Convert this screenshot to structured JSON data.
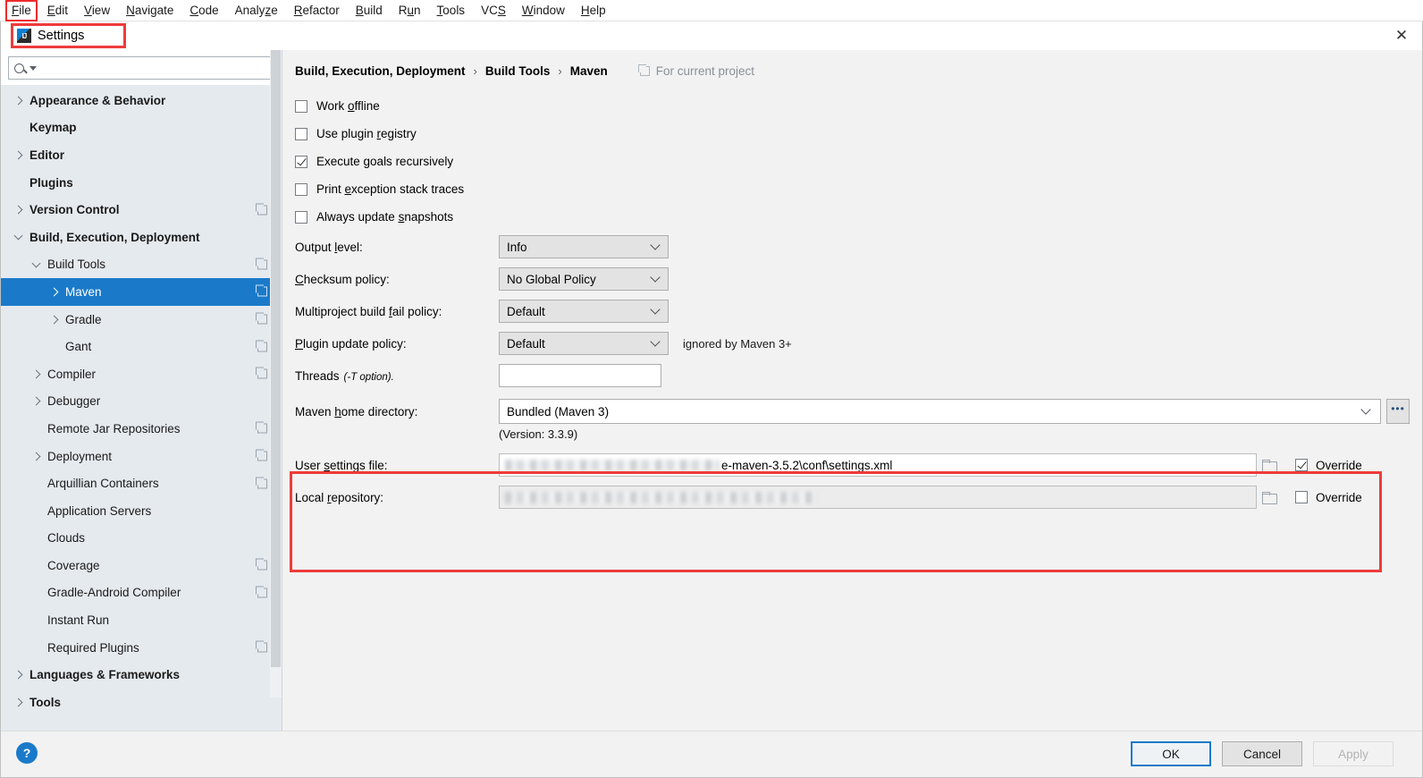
{
  "menubar": {
    "items": [
      {
        "label": "File",
        "mnemonic": "F",
        "highlighted": true
      },
      {
        "label": "Edit",
        "mnemonic": "E"
      },
      {
        "label": "View",
        "mnemonic": "V"
      },
      {
        "label": "Navigate",
        "mnemonic": "N"
      },
      {
        "label": "Code",
        "mnemonic": "C"
      },
      {
        "label": "Analyze",
        "mnemonic": "z"
      },
      {
        "label": "Refactor",
        "mnemonic": "R"
      },
      {
        "label": "Build",
        "mnemonic": "B"
      },
      {
        "label": "Run",
        "mnemonic": "u"
      },
      {
        "label": "Tools",
        "mnemonic": "T"
      },
      {
        "label": "VCS",
        "mnemonic": "S"
      },
      {
        "label": "Window",
        "mnemonic": "W"
      },
      {
        "label": "Help",
        "mnemonic": "H"
      }
    ]
  },
  "dialog": {
    "title": "Settings",
    "close_label": "✕"
  },
  "search": {
    "value": "",
    "placeholder": ""
  },
  "sidebar": {
    "items": [
      {
        "label": "Appearance & Behavior",
        "indent": 0,
        "bold": true,
        "chevron": "closed",
        "copy": false,
        "selected": false
      },
      {
        "label": "Keymap",
        "indent": 0,
        "bold": true,
        "chevron": "none",
        "copy": false,
        "selected": false
      },
      {
        "label": "Editor",
        "indent": 0,
        "bold": true,
        "chevron": "closed",
        "copy": false,
        "selected": false
      },
      {
        "label": "Plugins",
        "indent": 0,
        "bold": true,
        "chevron": "none",
        "copy": false,
        "selected": false
      },
      {
        "label": "Version Control",
        "indent": 0,
        "bold": true,
        "chevron": "closed",
        "copy": true,
        "selected": false
      },
      {
        "label": "Build, Execution, Deployment",
        "indent": 0,
        "bold": true,
        "chevron": "open",
        "copy": false,
        "selected": false
      },
      {
        "label": "Build Tools",
        "indent": 1,
        "bold": false,
        "chevron": "open",
        "copy": true,
        "selected": false
      },
      {
        "label": "Maven",
        "indent": 2,
        "bold": false,
        "chevron": "closed",
        "copy": true,
        "selected": true
      },
      {
        "label": "Gradle",
        "indent": 2,
        "bold": false,
        "chevron": "closed",
        "copy": true,
        "selected": false
      },
      {
        "label": "Gant",
        "indent": 2,
        "bold": false,
        "chevron": "none",
        "copy": true,
        "selected": false
      },
      {
        "label": "Compiler",
        "indent": 1,
        "bold": false,
        "chevron": "closed",
        "copy": true,
        "selected": false
      },
      {
        "label": "Debugger",
        "indent": 1,
        "bold": false,
        "chevron": "closed",
        "copy": false,
        "selected": false
      },
      {
        "label": "Remote Jar Repositories",
        "indent": 1,
        "bold": false,
        "chevron": "none",
        "copy": true,
        "selected": false
      },
      {
        "label": "Deployment",
        "indent": 1,
        "bold": false,
        "chevron": "closed",
        "copy": true,
        "selected": false
      },
      {
        "label": "Arquillian Containers",
        "indent": 1,
        "bold": false,
        "chevron": "none",
        "copy": true,
        "selected": false
      },
      {
        "label": "Application Servers",
        "indent": 1,
        "bold": false,
        "chevron": "none",
        "copy": false,
        "selected": false
      },
      {
        "label": "Clouds",
        "indent": 1,
        "bold": false,
        "chevron": "none",
        "copy": false,
        "selected": false
      },
      {
        "label": "Coverage",
        "indent": 1,
        "bold": false,
        "chevron": "none",
        "copy": true,
        "selected": false
      },
      {
        "label": "Gradle-Android Compiler",
        "indent": 1,
        "bold": false,
        "chevron": "none",
        "copy": true,
        "selected": false
      },
      {
        "label": "Instant Run",
        "indent": 1,
        "bold": false,
        "chevron": "none",
        "copy": false,
        "selected": false
      },
      {
        "label": "Required Plugins",
        "indent": 1,
        "bold": false,
        "chevron": "none",
        "copy": true,
        "selected": false
      },
      {
        "label": "Languages & Frameworks",
        "indent": 0,
        "bold": true,
        "chevron": "closed",
        "copy": false,
        "selected": false
      },
      {
        "label": "Tools",
        "indent": 0,
        "bold": true,
        "chevron": "closed",
        "copy": false,
        "selected": false
      }
    ]
  },
  "main": {
    "breadcrumb": [
      "Build, Execution, Deployment",
      "Build Tools",
      "Maven"
    ],
    "breadcrumb_separator": "›",
    "scope_label": "For current project",
    "checkboxes": [
      {
        "label_pre": "Work ",
        "label_mn": "o",
        "label_post": "ffline",
        "checked": false
      },
      {
        "label_pre": "Use plugin ",
        "label_mn": "r",
        "label_post": "egistry",
        "checked": false
      },
      {
        "label_pre": "Execute ",
        "label_mn": "g",
        "label_post": "oals recursively",
        "checked": true
      },
      {
        "label_pre": "Print ",
        "label_mn": "e",
        "label_post": "xception stack traces",
        "checked": false
      },
      {
        "label_pre": "Always update ",
        "label_mn": "s",
        "label_post": "napshots",
        "checked": false
      }
    ],
    "combos": [
      {
        "label_pre": "Output ",
        "label_mn": "l",
        "label_post": "evel:",
        "value": "Info",
        "hint": ""
      },
      {
        "label_pre": "",
        "label_mn": "C",
        "label_post": "hecksum policy:",
        "value": "No Global Policy",
        "hint": ""
      },
      {
        "label_pre": "Multiproject build ",
        "label_mn": "f",
        "label_post": "ail policy:",
        "value": "Default",
        "hint": ""
      },
      {
        "label_pre": "",
        "label_mn": "P",
        "label_post": "lugin update policy:",
        "value": "Default",
        "hint": "ignored by Maven 3+"
      }
    ],
    "threads": {
      "label": "Threads",
      "hint": "(-T option).",
      "value": ""
    },
    "maven_home": {
      "label_pre": "Maven ",
      "label_mn": "h",
      "label_post": "ome directory:",
      "value": "Bundled (Maven 3)",
      "browse_label": "•••",
      "version_text": "(Version: 3.3.9)"
    },
    "user_settings_file": {
      "label_pre": "User ",
      "label_mn": "s",
      "label_post": "ettings file:",
      "value_visible": "e-maven-3.5.2\\conf\\settings.xml",
      "value_redacted": true,
      "override_label": "Override",
      "override_checked": true,
      "enabled": true
    },
    "local_repository": {
      "label_pre": "Local ",
      "label_mn": "r",
      "label_post": "epository:",
      "value_visible": "",
      "value_redacted": true,
      "override_label": "Override",
      "override_checked": false,
      "enabled": false
    }
  },
  "footer": {
    "help_label": "?",
    "ok_label": "OK",
    "cancel_label": "Cancel",
    "apply_label": "Apply"
  },
  "colors": {
    "accent": "#1a7ac9",
    "annotation": "#ee3b3b",
    "sidebar_bg": "#e5eaef",
    "panel_bg": "#f2f2f2"
  }
}
